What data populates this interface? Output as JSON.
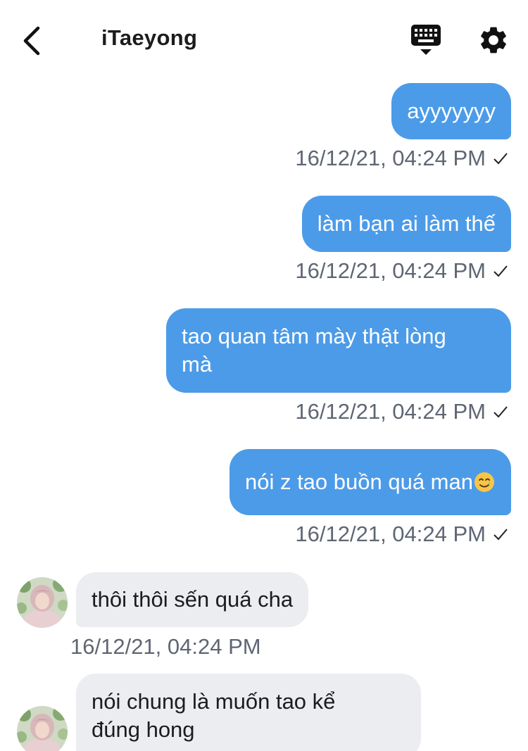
{
  "header": {
    "title": "iTaeyong",
    "back_icon": "chevron-left-icon",
    "keyboard_icon": "keyboard-icon",
    "settings_icon": "gear-icon"
  },
  "messages": [
    {
      "direction": "out",
      "text": "ayyyyyyy",
      "time": "16/12/21, 04:24 PM",
      "status": "sent"
    },
    {
      "direction": "out",
      "text": "làm bạn ai làm thế",
      "time": "16/12/21, 04:24 PM",
      "status": "sent"
    },
    {
      "direction": "out",
      "text": "tao quan tâm mày thật lòng\nmà",
      "time": "16/12/21, 04:24 PM",
      "status": "sent"
    },
    {
      "direction": "out",
      "text": "nói z tao buồn quá man",
      "emoji": "smiling-face-with-tear-icon",
      "time": "16/12/21, 04:24 PM",
      "status": "sent"
    },
    {
      "direction": "in",
      "text": "thôi thôi sến quá cha",
      "time": "16/12/21, 04:24 PM"
    },
    {
      "direction": "in",
      "text": "nói chung là muốn tao kể\nđúng hong"
    }
  ],
  "colors": {
    "outgoing_bubble": "#4c9be8",
    "incoming_bubble": "#ebedf0",
    "timestamp": "#5f6673",
    "header_text": "#1c1c1e"
  }
}
